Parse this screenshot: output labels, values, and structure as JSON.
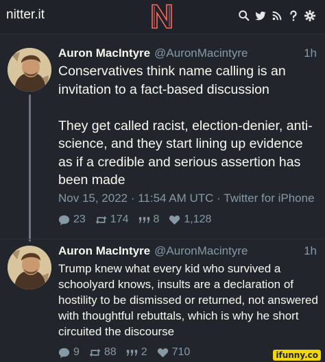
{
  "navbar": {
    "site_name": "nitter.it",
    "logo_icon": "nitter-n-logo",
    "icons": [
      "search-icon",
      "twitter-bird-icon",
      "rss-icon",
      "help-icon",
      "settings-icon"
    ],
    "logo_color": "#ff6c60"
  },
  "tweets": [
    {
      "fullname": "Auron MacIntyre",
      "username": "@AuronMacintyre",
      "date": "1h",
      "text": "Conservatives think name calling is an invitation to a fact-based discussion\n\nThey get called racist, election-denier, anti-science, and they start lining up evidence as if a credible and serious assertion has been made",
      "published": "Nov 15, 2022 · 11:54 AM UTC · Twitter for iPhone",
      "stats": {
        "replies": "23",
        "retweets": "174",
        "quotes": "8",
        "likes": "1,128"
      }
    },
    {
      "fullname": "Auron MacIntyre",
      "username": "@AuronMacintyre",
      "date": "1h",
      "text": "Trump knew what every kid who survived a schoolyard knows, insults are a declaration of hostility to be dismissed or returned, not answered with thoughtful rebuttals, which is why he short circuited the discourse",
      "stats": {
        "replies": "9",
        "retweets": "88",
        "quotes": "2",
        "likes": "710"
      }
    }
  ],
  "watermark": "ifunny.co",
  "colors": {
    "background": "#22252c",
    "text": "#f8f8f2",
    "muted": "#8899a6",
    "accent": "#ff6c60"
  }
}
